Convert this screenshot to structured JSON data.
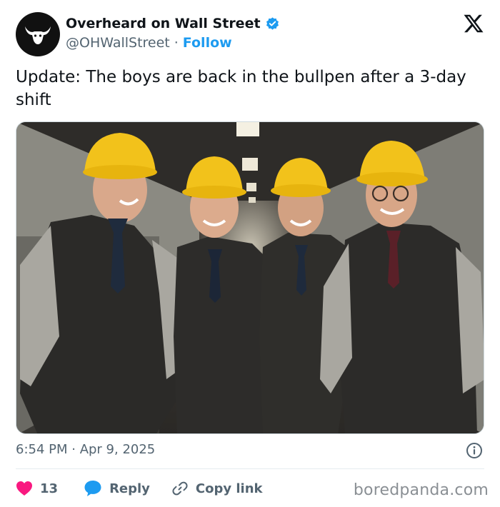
{
  "account": {
    "name": "Overheard on Wall Street",
    "handle": "@OHWallStreet",
    "separator": "·",
    "follow_label": "Follow",
    "avatar_icon": "bull-logo-icon",
    "verified_color": "#1d9bf0"
  },
  "tweet": {
    "text": "Update: The boys are back in the bullpen after a 3-day shift",
    "image_description_icon": "photo-of-four-men-in-hard-hats",
    "timestamp": "6:54 PM · Apr 9, 2025"
  },
  "actions": {
    "like_count": "13",
    "reply_label": "Reply",
    "copy_link_label": "Copy link",
    "like_color": "#f91880",
    "reply_color": "#1d9bf0"
  },
  "watermark": "boredpanda.com"
}
